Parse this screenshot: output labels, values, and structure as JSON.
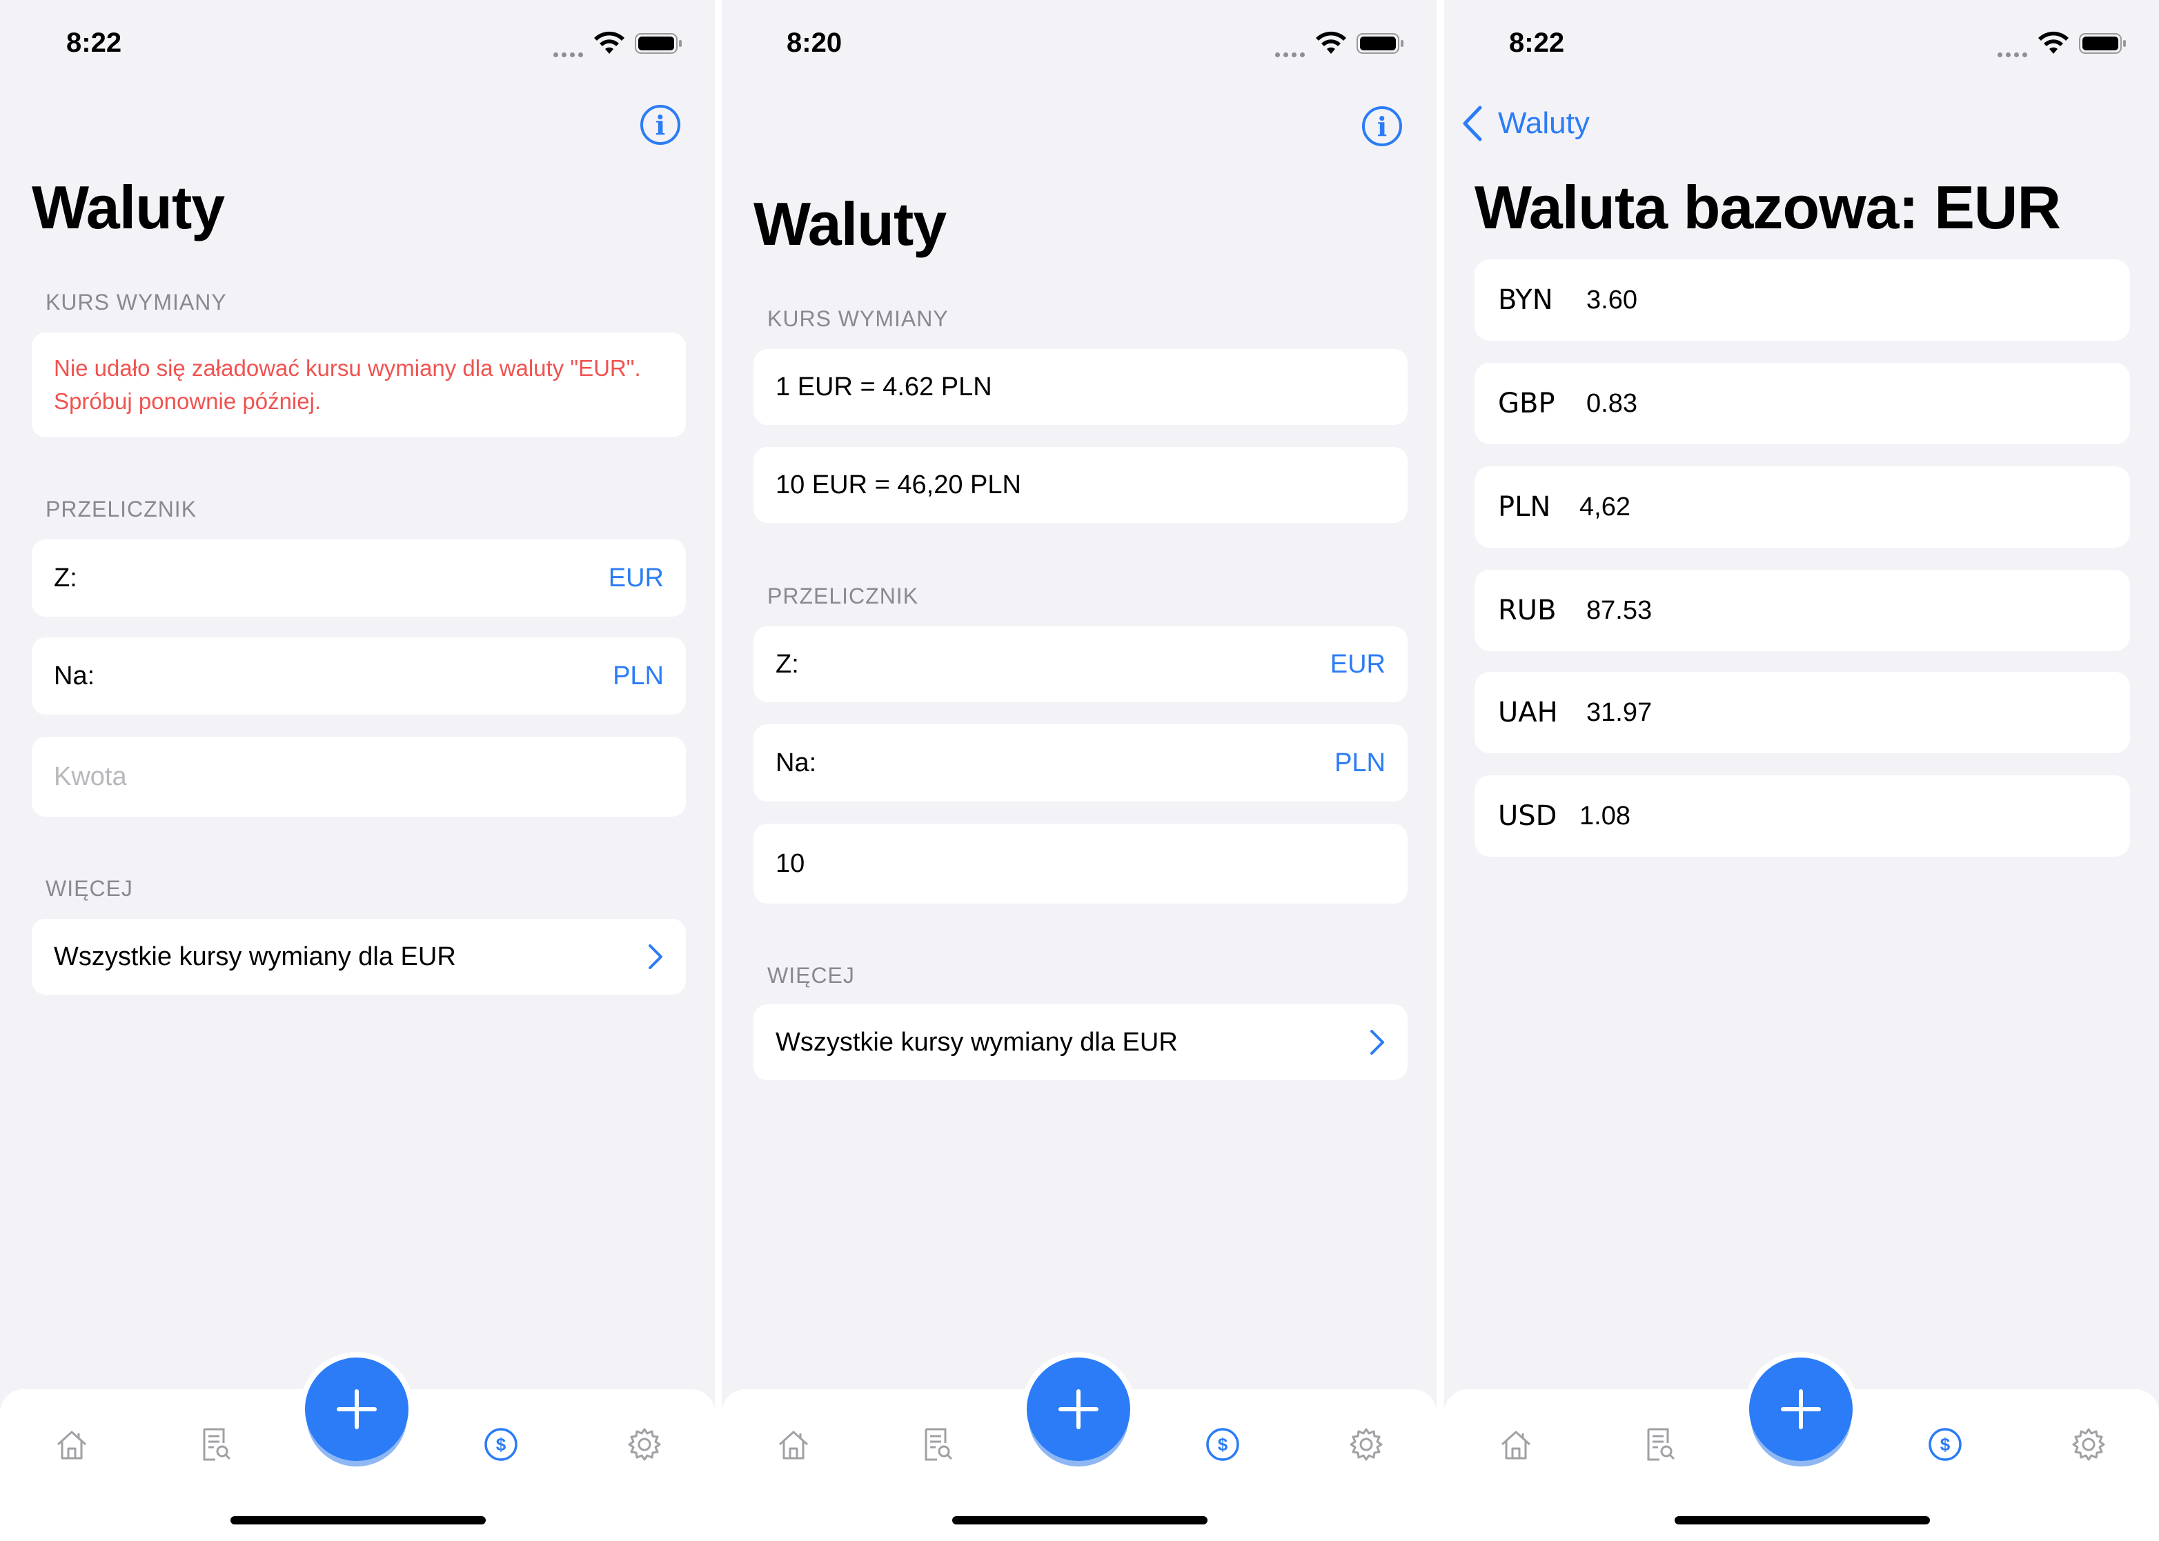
{
  "screens": [
    {
      "status": {
        "time": "8:22"
      },
      "title": "Waluty",
      "exchange_section": "KURS WYMIANY",
      "error_message": "Nie udało się załadować kursu wymiany dla waluty \"EUR\". Spróbuj ponownie później.",
      "converter_section": "PRZELICZNIK",
      "from_label": "Z:",
      "from_value": "EUR",
      "to_label": "Na:",
      "to_value": "PLN",
      "amount_placeholder": "Kwota",
      "more_section": "WIĘCEJ",
      "all_rates_link": "Wszystkie kursy wymiany dla EUR"
    },
    {
      "status": {
        "time": "8:20"
      },
      "title": "Waluty",
      "exchange_section": "KURS WYMIANY",
      "rate_line": "1 EUR = 4.62 PLN",
      "converted_line": "10 EUR = 46,20  PLN",
      "converter_section": "PRZELICZNIK",
      "from_label": "Z:",
      "from_value": "EUR",
      "to_label": "Na:",
      "to_value": "PLN",
      "amount_value": "10",
      "more_section": "WIĘCEJ",
      "all_rates_link": "Wszystkie kursy wymiany dla EUR"
    },
    {
      "status": {
        "time": "8:22"
      },
      "back_label": "Waluty",
      "title": "Waluta bazowa: EUR",
      "rates": [
        {
          "code": "BYN",
          "rate": "3.60"
        },
        {
          "code": "GBP",
          "rate": "0.83"
        },
        {
          "code": "PLN",
          "rate": "4,62"
        },
        {
          "code": "RUB",
          "rate": "87.53"
        },
        {
          "code": "UAH",
          "rate": "31.97"
        },
        {
          "code": "USD",
          "rate": "1.08"
        }
      ]
    }
  ],
  "tabbar": {
    "tabs": [
      "home-icon",
      "receipt-search-icon",
      "add-icon",
      "currency-dollar-icon",
      "gear-icon"
    ],
    "active_tab": "currency-dollar-icon"
  },
  "colors": {
    "accent": "#2b7cf6",
    "background": "#f2f2f7",
    "error": "#ef5350",
    "inactive_icon": "#a0a0a5"
  }
}
